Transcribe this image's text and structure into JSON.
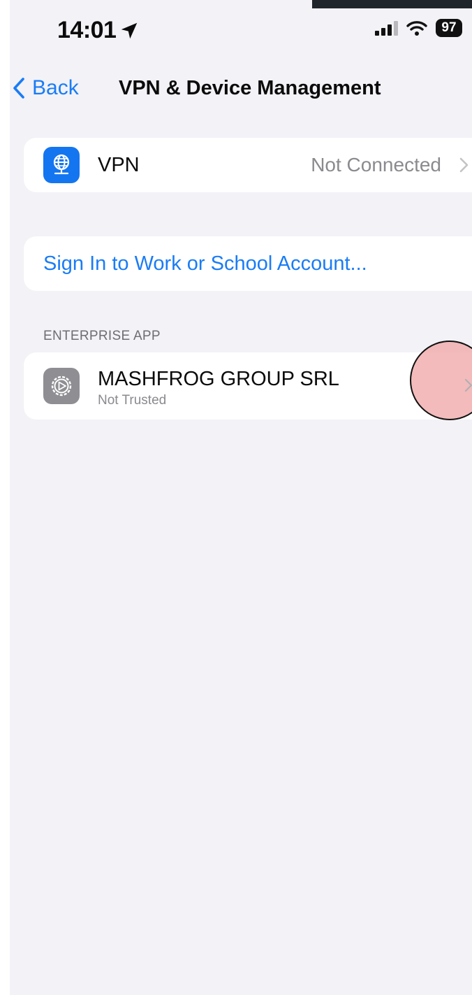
{
  "status_bar": {
    "time": "14:01",
    "battery": "97",
    "icons": [
      "location-arrow-icon",
      "cellular-signal-icon",
      "wifi-icon",
      "battery-icon"
    ]
  },
  "nav": {
    "back_label": "Back",
    "title": "VPN & Device Management"
  },
  "vpn_row": {
    "label": "VPN",
    "value": "Not Connected",
    "icon": "vpn-globe-icon"
  },
  "signin_row": {
    "label": "Sign In to Work or School Account..."
  },
  "enterprise_section": {
    "header": "ENTERPRISE APP",
    "app": {
      "title": "MASHFROG GROUP SRL",
      "subtitle": "Not Trusted",
      "icon": "settings-gear-icon"
    }
  },
  "colors": {
    "accent": "#1a7cf5",
    "background": "#f2f2f7",
    "vpn_icon_bg": "#1475f0",
    "app_icon_bg": "#8e8e93",
    "highlight": "#f0aaaa"
  }
}
